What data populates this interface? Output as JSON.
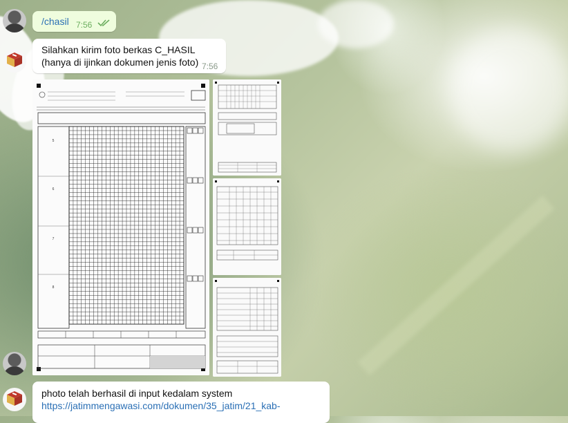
{
  "messages": [
    {
      "id": "m1",
      "sender": "user",
      "text": "/chasil",
      "time": "7:56",
      "read_status": "double-check"
    },
    {
      "id": "m2",
      "sender": "bot",
      "lines": [
        "Silahkan kirim foto berkas C_HASIL",
        "(hanya di ijinkan dokumen jenis foto)"
      ],
      "time": "7:56"
    },
    {
      "id": "m3",
      "sender": "user",
      "type": "photo-album",
      "photo_count": 4
    },
    {
      "id": "m4",
      "sender": "bot",
      "text": "photo telah berhasil di input kedalam system",
      "link": "https://jatimmengawasi.com/dokumen/35_jatim/21_kab-"
    }
  ],
  "icons": {
    "user_avatar": "user-photo-avatar",
    "bot_avatar": "bawaslu-box-logo-icon",
    "read_receipt": "double-check-icon"
  },
  "colors": {
    "outgoing_bubble": "#effdde",
    "incoming_bubble": "#ffffff",
    "link": "#2a6fb5",
    "check": "#6cae5f"
  }
}
